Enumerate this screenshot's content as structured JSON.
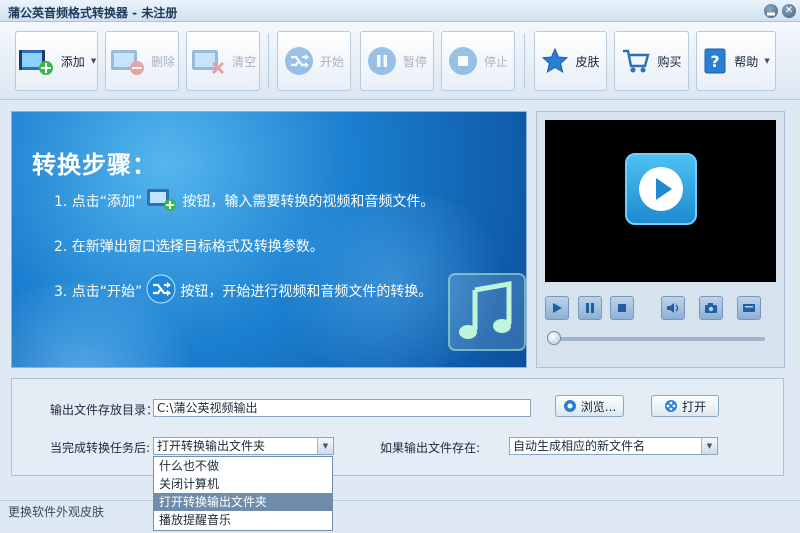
{
  "window": {
    "title": "蒲公英音频格式转换器 - 未注册",
    "min_glyph": "▂",
    "close_glyph": "✕"
  },
  "toolbar": {
    "add_label": "添加",
    "delete_label": "删除",
    "clear_label": "清空",
    "start_label": "开始",
    "pause_label": "暂停",
    "stop_label": "停止",
    "skin_label": "皮肤",
    "buy_label": "购买",
    "help_label": "帮助",
    "dropdown_glyph": "▼"
  },
  "banner": {
    "heading": "转换步骤：",
    "step1_a": "1. 点击“添加”",
    "step1_b": "按钮，输入需要转换的视频和音频文件。",
    "step2": "2. 在新弹出窗口选择目标格式及转换参数。",
    "step3_a": "3. 点击“开始”",
    "step3_b": "按钮，开始进行视频和音频文件的转换。"
  },
  "output": {
    "dir_label": "输出文件存放目录：",
    "dir_value": "C:\\蒲公英视频输出",
    "browse_label": "浏览...",
    "open_label": "打开",
    "after_label": "当完成转换任务后:",
    "after_value": "打开转换输出文件夹",
    "exists_label": "如果输出文件存在:",
    "exists_value": "自动生成相应的新文件名",
    "after_options": [
      "什么也不做",
      "关闭计算机",
      "打开转换输出文件夹",
      "播放提醒音乐"
    ],
    "after_selected_index": 2
  },
  "status": {
    "text": "更换软件外观皮肤"
  },
  "colors": {
    "accent": "#1b7fcf",
    "selection": "#6f8cab"
  }
}
